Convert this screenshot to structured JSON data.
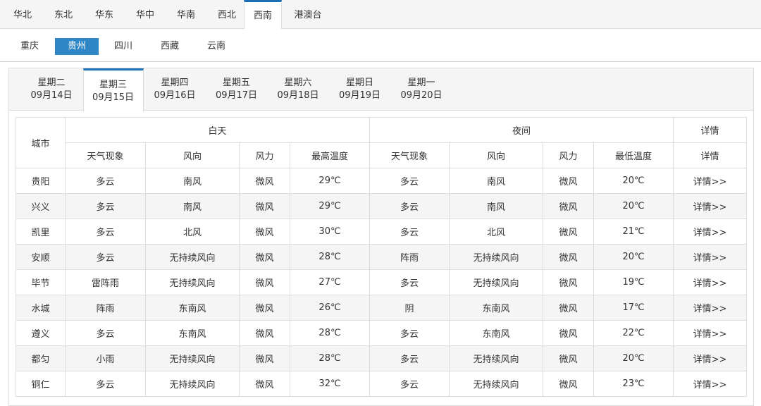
{
  "regions": [
    "华北",
    "东北",
    "华东",
    "华中",
    "华南",
    "西北",
    "西南",
    "港澳台"
  ],
  "active_region": "西南",
  "provinces": [
    "重庆",
    "贵州",
    "四川",
    "西藏",
    "云南"
  ],
  "active_province": "贵州",
  "days": [
    {
      "week": "星期二",
      "date": "09月14日"
    },
    {
      "week": "星期三",
      "date": "09月15日"
    },
    {
      "week": "星期四",
      "date": "09月16日"
    },
    {
      "week": "星期五",
      "date": "09月17日"
    },
    {
      "week": "星期六",
      "date": "09月18日"
    },
    {
      "week": "星期日",
      "date": "09月19日"
    },
    {
      "week": "星期一",
      "date": "09月20日"
    }
  ],
  "active_day": "09月15日",
  "table": {
    "city_header": "城市",
    "day_header": "白天",
    "night_header": "夜间",
    "detail_header": "详情",
    "sub_headers": [
      "天气现象",
      "风向",
      "风力",
      "最高温度",
      "天气现象",
      "风向",
      "风力",
      "最低温度",
      "详情"
    ],
    "rows": [
      [
        "贵阳",
        "多云",
        "南风",
        "微风",
        "29℃",
        "多云",
        "南风",
        "微风",
        "20℃",
        "详情>>"
      ],
      [
        "兴义",
        "多云",
        "南风",
        "微风",
        "29℃",
        "多云",
        "南风",
        "微风",
        "20℃",
        "详情>>"
      ],
      [
        "凯里",
        "多云",
        "北风",
        "微风",
        "30℃",
        "多云",
        "北风",
        "微风",
        "21℃",
        "详情>>"
      ],
      [
        "安顺",
        "多云",
        "无持续风向",
        "微风",
        "28℃",
        "阵雨",
        "无持续风向",
        "微风",
        "20℃",
        "详情>>"
      ],
      [
        "毕节",
        "雷阵雨",
        "无持续风向",
        "微风",
        "27℃",
        "多云",
        "无持续风向",
        "微风",
        "19℃",
        "详情>>"
      ],
      [
        "水城",
        "阵雨",
        "东南风",
        "微风",
        "26℃",
        "阴",
        "东南风",
        "微风",
        "17℃",
        "详情>>"
      ],
      [
        "遵义",
        "多云",
        "东南风",
        "微风",
        "28℃",
        "多云",
        "东南风",
        "微风",
        "22℃",
        "详情>>"
      ],
      [
        "都匀",
        "小雨",
        "无持续风向",
        "微风",
        "28℃",
        "多云",
        "无持续风向",
        "微风",
        "20℃",
        "详情>>"
      ],
      [
        "铜仁",
        "多云",
        "无持续风向",
        "微风",
        "32℃",
        "多云",
        "无持续风向",
        "微风",
        "23℃",
        "详情>>"
      ]
    ]
  }
}
